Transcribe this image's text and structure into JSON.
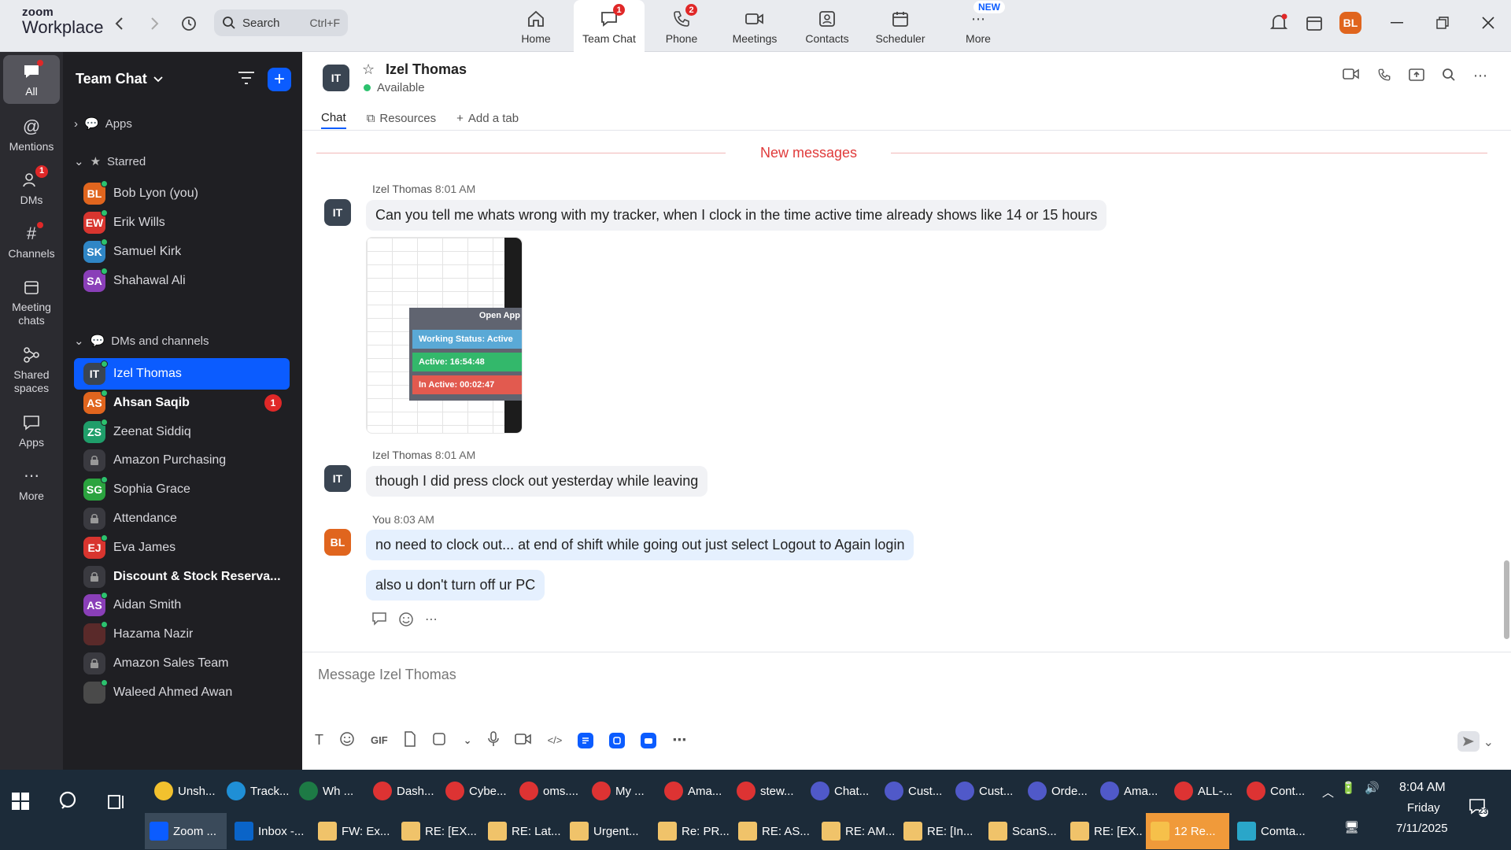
{
  "app": {
    "brand_line1": "zoom",
    "brand_line2": "Workplace",
    "search_label": "Search",
    "search_shortcut": "Ctrl+F",
    "user_initials": "BL",
    "accent": "#0b5cff"
  },
  "nav": [
    {
      "label": "Home",
      "icon": "home-icon",
      "badge": ""
    },
    {
      "label": "Team Chat",
      "icon": "chat-icon",
      "badge": "1"
    },
    {
      "label": "Phone",
      "icon": "phone-icon",
      "badge": "2"
    },
    {
      "label": "Meetings",
      "icon": "video-icon",
      "badge": ""
    },
    {
      "label": "Contacts",
      "icon": "contacts-icon",
      "badge": ""
    },
    {
      "label": "Scheduler",
      "icon": "calendar-icon",
      "badge": ""
    },
    {
      "label": "More",
      "icon": "more-icon",
      "badge": "NEW"
    }
  ],
  "rail": [
    {
      "label": "All",
      "icon": "chat-bubble-icon"
    },
    {
      "label": "Mentions",
      "icon": "at-icon"
    },
    {
      "label": "DMs",
      "icon": "people-icon",
      "badge": "1"
    },
    {
      "label": "Channels",
      "icon": "hash-icon"
    },
    {
      "label": "Meeting chats",
      "icon": "calendar-icon"
    },
    {
      "label": "Shared spaces",
      "icon": "share-icon"
    },
    {
      "label": "Apps",
      "icon": "apps-icon"
    },
    {
      "label": "More",
      "icon": "more-icon"
    }
  ],
  "sidebar": {
    "title": "Team Chat",
    "sections": {
      "apps": "Apps",
      "starred": "Starred",
      "dms": "DMs and channels"
    },
    "starred": [
      {
        "initials": "BL",
        "name": "Bob Lyon (you)",
        "color": "#e0651e"
      },
      {
        "initials": "EW",
        "name": "Erik Wills",
        "color": "#d8352f"
      },
      {
        "initials": "SK",
        "name": "Samuel Kirk",
        "color": "#2f86c6"
      },
      {
        "initials": "SA",
        "name": "Shahawal Ali",
        "color": "#8a3fb8"
      }
    ],
    "dms": [
      {
        "initials": "IT",
        "name": "Izel Thomas",
        "color": "#3a4552",
        "active": true
      },
      {
        "initials": "AS",
        "name": "Ahsan Saqib",
        "color": "#e0651e",
        "bold": true,
        "count": "1"
      },
      {
        "initials": "ZS",
        "name": "Zeenat Siddiq",
        "color": "#1f9e6a"
      },
      {
        "initials": "",
        "name": "Amazon Purchasing",
        "lock": true
      },
      {
        "initials": "SG",
        "name": "Sophia Grace",
        "color": "#2ba33f"
      },
      {
        "initials": "",
        "name": "Attendance",
        "lock": true
      },
      {
        "initials": "EJ",
        "name": "Eva James",
        "color": "#d8352f"
      },
      {
        "initials": "",
        "name": "Discount & Stock Reserva...",
        "lock": true,
        "bold": true
      },
      {
        "initials": "AS",
        "name": "Aidan Smith",
        "color": "#8a3fb8"
      },
      {
        "initials": "",
        "name": "Hazama Nazir",
        "color": "#5a2a2a"
      },
      {
        "initials": "",
        "name": "Amazon Sales Team",
        "lock": true
      },
      {
        "initials": "",
        "name": "Waleed Ahmed Awan",
        "color": "#4a4a4a"
      }
    ]
  },
  "chat": {
    "contact_initials": "IT",
    "contact_name": "Izel Thomas",
    "status": "Available",
    "tabs": [
      "Chat",
      "Resources",
      "Add a tab"
    ],
    "new_messages": "New messages",
    "messages": [
      {
        "sender": "Izel Thomas",
        "time": "8:01 AM",
        "text": "Can you tell me whats wrong with my tracker, when I clock in the time active time already shows like 14 or 15 hours"
      },
      {
        "sender": "Izel Thomas",
        "time": "8:01 AM",
        "text": "though I did press clock out yesterday while leaving"
      },
      {
        "sender": "You",
        "time": "8:03 AM",
        "text": "no need to clock out... at end of shift while going out just select Logout to Again login"
      },
      {
        "sender": "You",
        "time": "",
        "text": "also u don't turn off ur PC"
      }
    ],
    "image_widget": {
      "open_app": "Open App",
      "working_status": "Working Status: Active",
      "active": "Active: 16:54:48",
      "inactive": "In Active: 00:02:47"
    },
    "composer_placeholder": "Message Izel Thomas",
    "gif_label": "GIF"
  },
  "taskbar": {
    "row1": [
      {
        "label": "Unsh...",
        "color": "#f2c12e"
      },
      {
        "label": "Track...",
        "color": "#1f8fd6"
      },
      {
        "label": "Wh ...",
        "color": "#1d7a45"
      },
      {
        "label": "Dash...",
        "color": "#d33"
      },
      {
        "label": "Cybe...",
        "color": "#d33"
      },
      {
        "label": "oms....",
        "color": "#d33"
      },
      {
        "label": "My ...",
        "color": "#d33"
      },
      {
        "label": "Ama...",
        "color": "#d33"
      },
      {
        "label": "stew...",
        "color": "#d33"
      },
      {
        "label": "Chat...",
        "color": "#5059c9"
      },
      {
        "label": "Cust...",
        "color": "#5059c9"
      },
      {
        "label": "Cust...",
        "color": "#5059c9"
      },
      {
        "label": "Orde...",
        "color": "#5059c9"
      },
      {
        "label": "Ama...",
        "color": "#5059c9"
      },
      {
        "label": "ALL-...",
        "color": "#d33"
      },
      {
        "label": "Cont...",
        "color": "#d33"
      }
    ],
    "row2": [
      {
        "label": "Zoom ...",
        "color": "#0b5cff",
        "open": true
      },
      {
        "label": "Inbox -...",
        "color": "#0a64c8"
      },
      {
        "label": "FW: Ex...",
        "color": "#f0c36a"
      },
      {
        "label": "RE: [EX...",
        "color": "#f0c36a"
      },
      {
        "label": "RE: Lat...",
        "color": "#f0c36a"
      },
      {
        "label": "Urgent...",
        "color": "#f0c36a"
      },
      {
        "label": "Re: PR...",
        "color": "#f0c36a"
      },
      {
        "label": "RE: AS...",
        "color": "#f0c36a"
      },
      {
        "label": "RE: AM...",
        "color": "#f0c36a"
      },
      {
        "label": "RE: [In...",
        "color": "#f0c36a"
      },
      {
        "label": "ScanS...",
        "color": "#f0c36a"
      },
      {
        "label": "RE: [EX...",
        "color": "#f0c36a"
      },
      {
        "label": "12 Re...",
        "color": "#f6c04a",
        "highlight": true
      },
      {
        "label": "Comta...",
        "color": "#2aa6c9"
      }
    ],
    "time": "8:04 AM",
    "day": "Friday",
    "date": "7/11/2025",
    "notif_count": "23"
  }
}
